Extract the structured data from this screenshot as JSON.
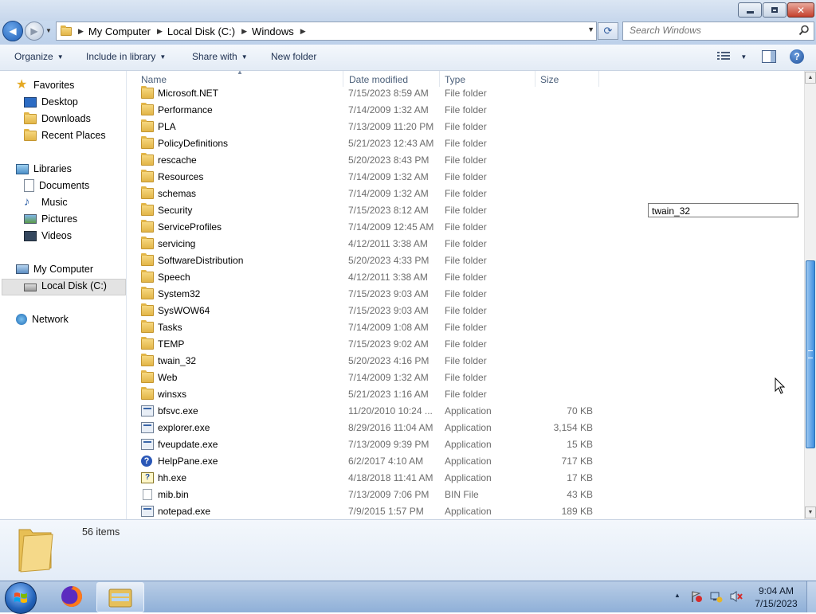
{
  "titlebar": {
    "controls": [
      "minimize",
      "maximize",
      "close"
    ]
  },
  "address": {
    "crumbs": [
      "My Computer",
      "Local Disk (C:)",
      "Windows"
    ],
    "search_placeholder": "Search Windows"
  },
  "toolbar": {
    "organize": "Organize",
    "include_in_library": "Include in library",
    "share_with": "Share with",
    "new_folder": "New folder"
  },
  "nav": {
    "favorites": "Favorites",
    "desktop": "Desktop",
    "downloads": "Downloads",
    "recent_places": "Recent Places",
    "libraries": "Libraries",
    "documents": "Documents",
    "music": "Music",
    "pictures": "Pictures",
    "videos": "Videos",
    "my_computer": "My Computer",
    "local_disk": "Local Disk (C:)",
    "network": "Network"
  },
  "columns": {
    "name": "Name",
    "date": "Date modified",
    "type": "Type",
    "size": "Size"
  },
  "files": [
    {
      "name": "Microsoft.NET",
      "date": "7/15/2023 8:59 AM",
      "type": "File folder",
      "size": "",
      "icon": "folder-icon"
    },
    {
      "name": "Performance",
      "date": "7/14/2009 1:32 AM",
      "type": "File folder",
      "size": "",
      "icon": "folder-icon"
    },
    {
      "name": "PLA",
      "date": "7/13/2009 11:20 PM",
      "type": "File folder",
      "size": "",
      "icon": "folder-icon"
    },
    {
      "name": "PolicyDefinitions",
      "date": "5/21/2023 12:43 AM",
      "type": "File folder",
      "size": "",
      "icon": "folder-icon"
    },
    {
      "name": "rescache",
      "date": "5/20/2023 8:43 PM",
      "type": "File folder",
      "size": "",
      "icon": "folder-icon"
    },
    {
      "name": "Resources",
      "date": "7/14/2009 1:32 AM",
      "type": "File folder",
      "size": "",
      "icon": "folder-icon"
    },
    {
      "name": "schemas",
      "date": "7/14/2009 1:32 AM",
      "type": "File folder",
      "size": "",
      "icon": "folder-icon"
    },
    {
      "name": "Security",
      "date": "7/15/2023 8:12 AM",
      "type": "File folder",
      "size": "",
      "icon": "folder-icon"
    },
    {
      "name": "ServiceProfiles",
      "date": "7/14/2009 12:45 AM",
      "type": "File folder",
      "size": "",
      "icon": "folder-icon"
    },
    {
      "name": "servicing",
      "date": "4/12/2011 3:38 AM",
      "type": "File folder",
      "size": "",
      "icon": "folder-icon"
    },
    {
      "name": "SoftwareDistribution",
      "date": "5/20/2023 4:33 PM",
      "type": "File folder",
      "size": "",
      "icon": "folder-icon"
    },
    {
      "name": "Speech",
      "date": "4/12/2011 3:38 AM",
      "type": "File folder",
      "size": "",
      "icon": "folder-icon"
    },
    {
      "name": "System32",
      "date": "7/15/2023 9:03 AM",
      "type": "File folder",
      "size": "",
      "icon": "folder-icon"
    },
    {
      "name": "SysWOW64",
      "date": "7/15/2023 9:03 AM",
      "type": "File folder",
      "size": "",
      "icon": "folder-icon"
    },
    {
      "name": "Tasks",
      "date": "7/14/2009 1:08 AM",
      "type": "File folder",
      "size": "",
      "icon": "folder-icon"
    },
    {
      "name": "TEMP",
      "date": "7/15/2023 9:02 AM",
      "type": "File folder",
      "size": "",
      "icon": "folder-icon"
    },
    {
      "name": "twain_32",
      "date": "5/20/2023 4:16 PM",
      "type": "File folder",
      "size": "",
      "icon": "folder-icon"
    },
    {
      "name": "Web",
      "date": "7/14/2009 1:32 AM",
      "type": "File folder",
      "size": "",
      "icon": "folder-icon"
    },
    {
      "name": "winsxs",
      "date": "5/21/2023 1:16 AM",
      "type": "File folder",
      "size": "",
      "icon": "folder-icon"
    },
    {
      "name": "bfsvc.exe",
      "date": "11/20/2010 10:24 ...",
      "type": "Application",
      "size": "70 KB",
      "icon": "application-icon"
    },
    {
      "name": "explorer.exe",
      "date": "8/29/2016 11:04 AM",
      "type": "Application",
      "size": "3,154 KB",
      "icon": "explorer-app-icon"
    },
    {
      "name": "fveupdate.exe",
      "date": "7/13/2009 9:39 PM",
      "type": "Application",
      "size": "15 KB",
      "icon": "application-icon"
    },
    {
      "name": "HelpPane.exe",
      "date": "6/2/2017 4:10 AM",
      "type": "Application",
      "size": "717 KB",
      "icon": "help-icon"
    },
    {
      "name": "hh.exe",
      "date": "4/18/2018 11:41 AM",
      "type": "Application",
      "size": "17 KB",
      "icon": "help-file-icon"
    },
    {
      "name": "mib.bin",
      "date": "7/13/2009 7:06 PM",
      "type": "BIN File",
      "size": "43 KB",
      "icon": "document-icon"
    },
    {
      "name": "notepad.exe",
      "date": "7/9/2015 1:57 PM",
      "type": "Application",
      "size": "189 KB",
      "icon": "notepad-icon"
    }
  ],
  "rename_box": "twain_32",
  "details": {
    "item_count": "56 items"
  },
  "taskbar": {
    "time": "9:04 AM",
    "date": "7/15/2023"
  }
}
